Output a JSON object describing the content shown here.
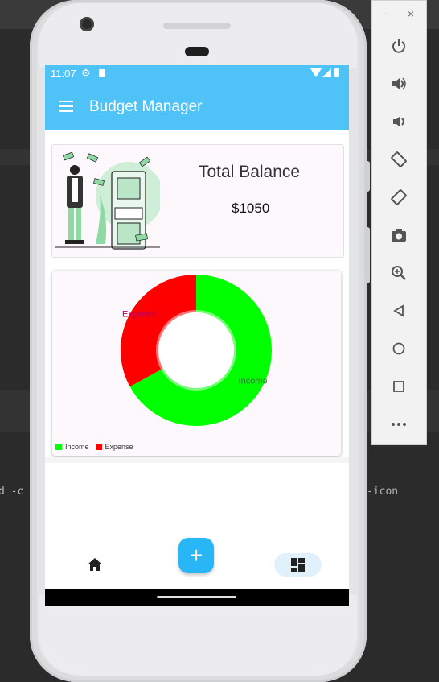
{
  "background": {
    "left_snippet": "d -c",
    "right_snippet": "-icon"
  },
  "statusbar": {
    "time": "11:07",
    "icons": [
      "gear-icon",
      "sd-card-icon",
      "wifi-icon",
      "signal-icon",
      "battery-icon"
    ]
  },
  "appbar": {
    "title": "Budget Manager",
    "menu_icon": "hamburger-menu-icon"
  },
  "balance_card": {
    "title": "Total Balance",
    "amount": "$1050",
    "illustration": "man-with-money-illustration"
  },
  "chart_data": {
    "type": "pie",
    "variant": "donut",
    "categories": [
      "Income",
      "Expense"
    ],
    "values": [
      67,
      33
    ],
    "colors": [
      "#00ff00",
      "#ff0000"
    ],
    "slice_labels": [
      "Income",
      "Expense"
    ],
    "legend": {
      "placement": "bottom-left",
      "entries": [
        {
          "label": "Income",
          "color": "#00ff00"
        },
        {
          "label": "Expense",
          "color": "#ff0000"
        }
      ]
    }
  },
  "fab": {
    "label": "+"
  },
  "bottom_nav": {
    "items": [
      {
        "name": "home",
        "icon": "home-icon",
        "selected": false
      },
      {
        "name": "dashboard",
        "icon": "dashboard-icon",
        "selected": true
      }
    ]
  },
  "emulator_panel": {
    "window_controls": [
      "−",
      "×"
    ],
    "buttons": [
      "power-icon",
      "volume-up-icon",
      "volume-down-icon",
      "rotate-left-icon",
      "rotate-right-icon",
      "camera-icon",
      "zoom-icon",
      "back-icon",
      "home-circle-icon",
      "overview-icon",
      "more-icon"
    ]
  },
  "colors": {
    "accent": "#4fc3f7",
    "fab": "#29b6f6",
    "income": "#00ff00",
    "expense": "#ff0000"
  }
}
